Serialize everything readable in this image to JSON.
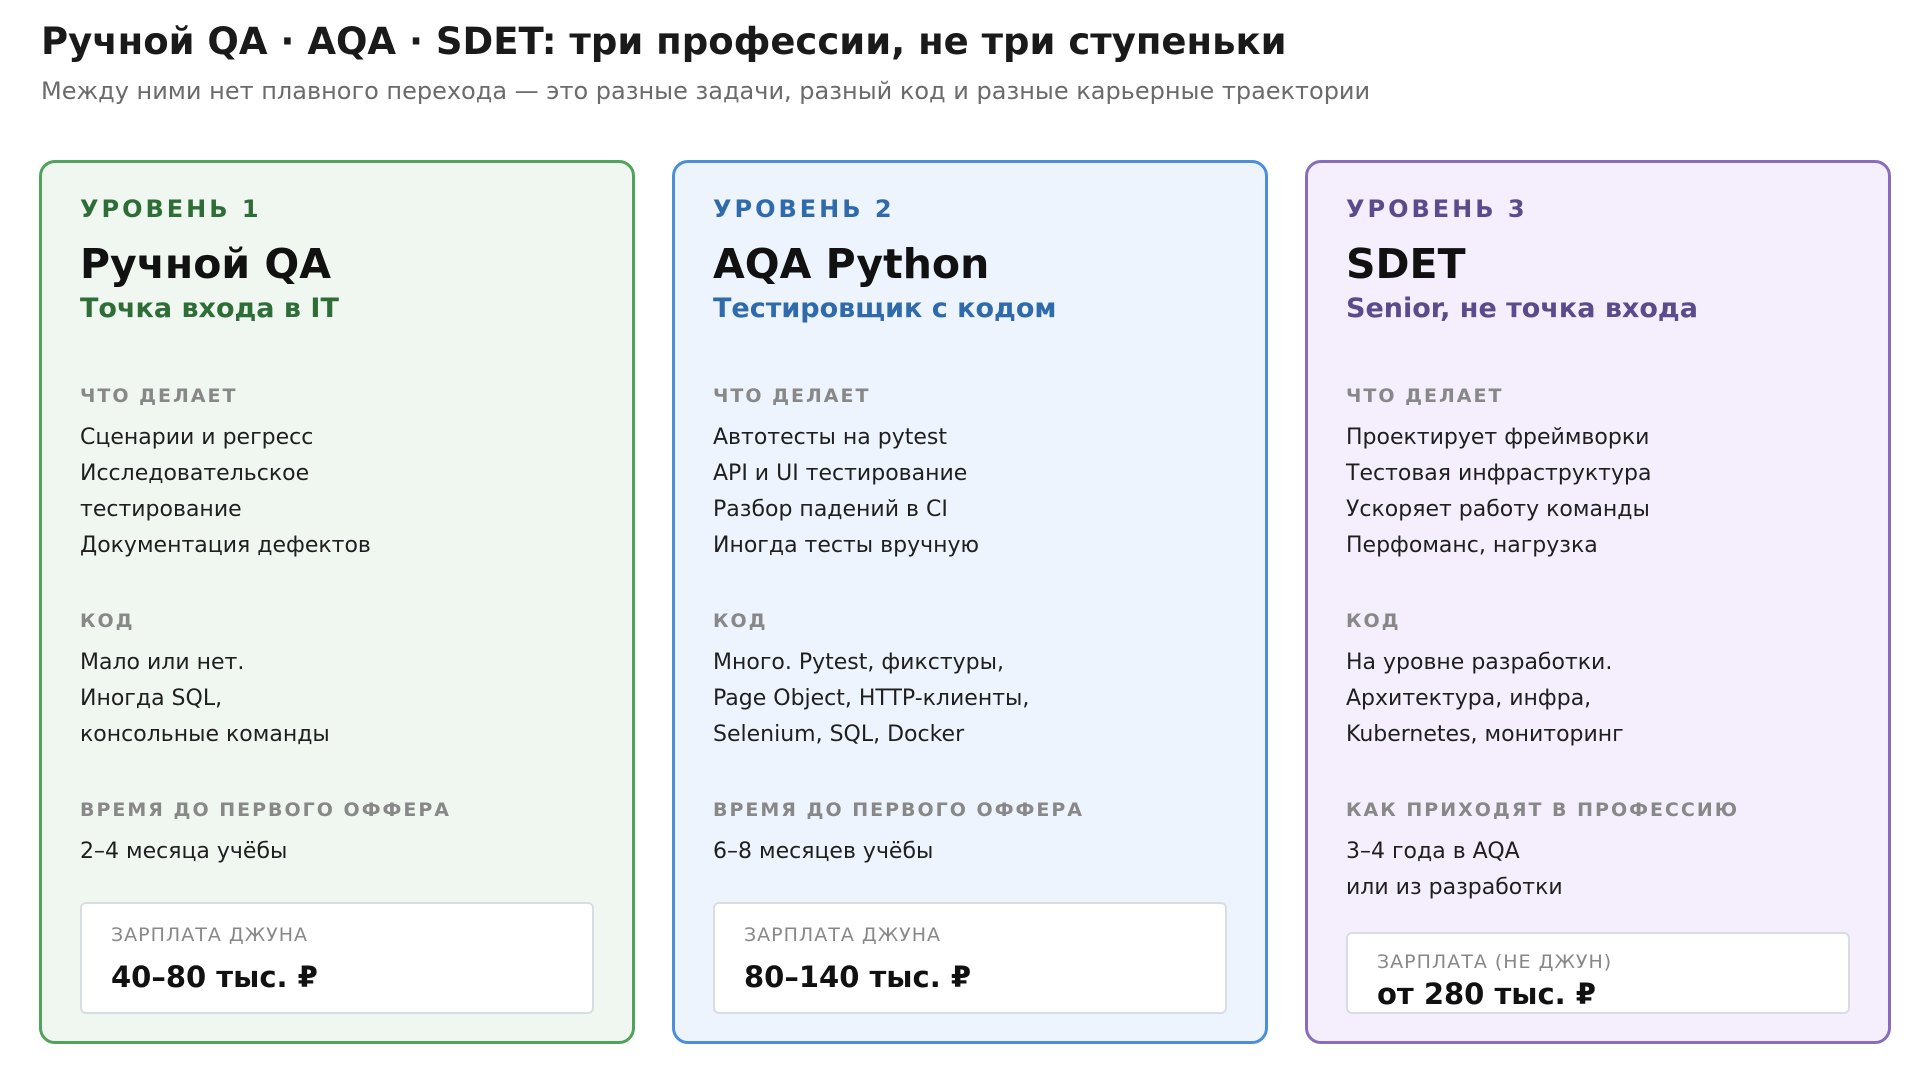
{
  "header": {
    "title": "Ручной QA · AQA · SDET: три профессии, не три ступеньки",
    "subtitle": "Между ними нет плавного перехода — это разные задачи, разный код и разные карьерные траектории"
  },
  "cards": [
    {
      "level": "УРОВЕНЬ 1",
      "role": "Ручной QA",
      "tagline": "Точка входа в IT",
      "accent": "#4fa35a",
      "does_label": "ЧТО ДЕЛАЕТ",
      "does": [
        "Сценарии и регресс",
        "Исследовательское",
        "тестирование",
        "Документация дефектов"
      ],
      "code_label": "КОД",
      "code": [
        "Мало или нет.",
        "Иногда SQL,",
        "консольные команды"
      ],
      "time_label": "ВРЕМЯ ДО ПЕРВОГО ОФФЕРА",
      "time": [
        "2–4 месяца учёбы"
      ],
      "salary_label": "ЗАРПЛАТА ДЖУНА",
      "salary": "40–80 тыс. ₽"
    },
    {
      "level": "УРОВЕНЬ 2",
      "role": "AQA Python",
      "tagline": "Тестировщик с кодом",
      "accent": "#4a8fd8",
      "does_label": "ЧТО ДЕЛАЕТ",
      "does": [
        "Автотесты на pytest",
        "API и UI тестирование",
        "Разбор падений в CI",
        "Иногда тесты вручную"
      ],
      "code_label": "КОД",
      "code": [
        "Много. Pytest, фикстуры,",
        "Page Object, HTTP-клиенты,",
        "Selenium, SQL, Docker"
      ],
      "time_label": "ВРЕМЯ ДО ПЕРВОГО ОФФЕРА",
      "time": [
        "6–8 месяцев учёбы"
      ],
      "salary_label": "ЗАРПЛАТА ДЖУНА",
      "salary": "80–140 тыс. ₽"
    },
    {
      "level": "УРОВЕНЬ 3",
      "role": "SDET",
      "tagline": "Senior, не точка входа",
      "accent": "#8a6cbc",
      "does_label": "ЧТО ДЕЛАЕТ",
      "does": [
        "Проектирует фреймворки",
        "Тестовая инфраструктура",
        "Ускоряет работу команды",
        "Перфоманс, нагрузка"
      ],
      "code_label": "КОД",
      "code": [
        "На уровне разработки.",
        "Архитектура, инфра,",
        "Kubernetes, мониторинг"
      ],
      "time_label": "КАК ПРИХОДЯТ В ПРОФЕССИЮ",
      "time": [
        "3–4 года в AQA",
        "или из разработки"
      ],
      "salary_label": "ЗАРПЛАТА (НЕ ДЖУН)",
      "salary": "от 280 тыс. ₽"
    }
  ]
}
